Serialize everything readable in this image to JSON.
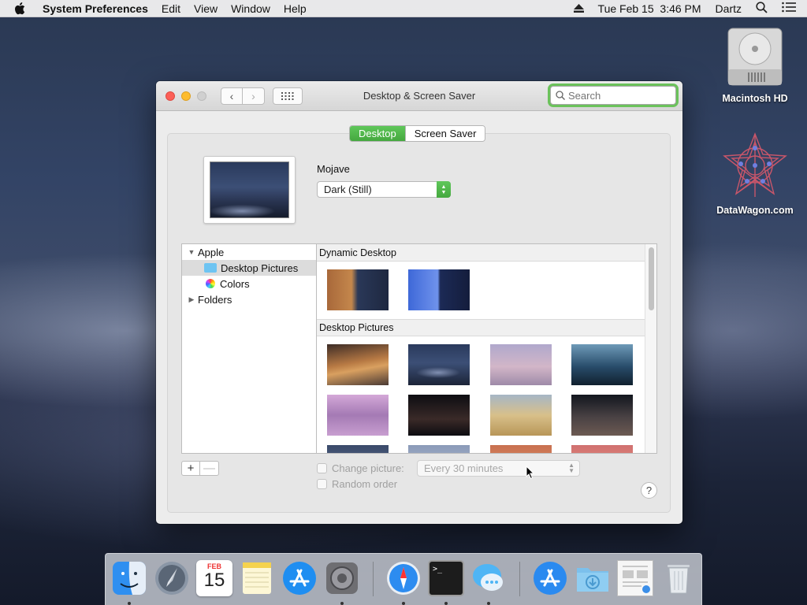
{
  "menubar": {
    "app_name": "System Preferences",
    "menus": [
      "Edit",
      "View",
      "Window",
      "Help"
    ],
    "datetime": "Tue Feb 15  3:46 PM",
    "user": "Dartz"
  },
  "desktop": {
    "icons": [
      {
        "label": "Macintosh HD"
      },
      {
        "label": "DataWagon.com"
      }
    ]
  },
  "window": {
    "title": "Desktop & Screen Saver",
    "search_placeholder": "Search",
    "tabs": [
      {
        "label": "Desktop",
        "active": true
      },
      {
        "label": "Screen Saver",
        "active": false
      }
    ],
    "wallpaper_name": "Mojave",
    "appearance_option": "Dark (Still)",
    "source_list": [
      {
        "label": "Apple",
        "expanded": true
      },
      {
        "label": "Desktop Pictures",
        "selected": true
      },
      {
        "label": "Colors"
      },
      {
        "label": "Folders",
        "expanded": false
      }
    ],
    "sections": [
      {
        "title": "Dynamic Desktop"
      },
      {
        "title": "Desktop Pictures"
      }
    ],
    "change_picture_label": "Change picture:",
    "interval": "Every 30 minutes",
    "random_order_label": "Random order",
    "help_label": "?",
    "add_label": "+",
    "remove_label": "—"
  },
  "dock": {
    "calendar_month": "FEB",
    "calendar_day": "15",
    "terminal_prompt": ">_"
  },
  "colors": {
    "accent_green": "#5fc75a",
    "close_red": "#fc5f57",
    "minimize_yellow": "#fdbc2e"
  }
}
